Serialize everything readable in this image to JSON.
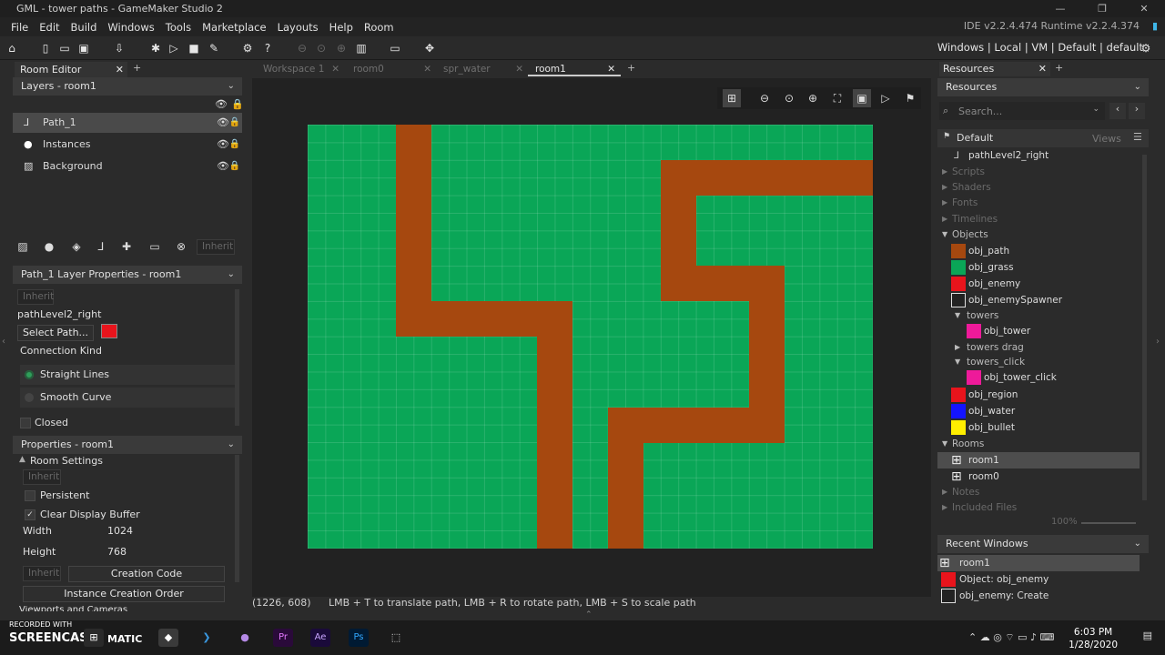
{
  "window": {
    "title": "GML - tower paths - GameMaker Studio 2",
    "version": "IDE v2.2.4.474  Runtime v2.2.4.374"
  },
  "menu": [
    "File",
    "Edit",
    "Build",
    "Windows",
    "Tools",
    "Marketplace",
    "Layouts",
    "Help",
    "Room"
  ],
  "targets": "Windows | Local | VM | Default | default",
  "left": {
    "tab": "Room Editor",
    "layers_header": "Layers - room1",
    "layers": [
      {
        "name": "Path_1",
        "icon": "path-icon"
      },
      {
        "name": "Instances",
        "icon": "circle-icon"
      },
      {
        "name": "Background",
        "icon": "image-icon"
      }
    ],
    "inherit": "Inherit",
    "layer_props_header": "Path_1 Layer Properties - room1",
    "path_name": "pathLevel2_right",
    "select_path": "Select Path...",
    "path_color": "#e8141c",
    "connection_kind": "Connection Kind",
    "straight": "Straight Lines",
    "smooth": "Smooth Curve",
    "closed": "Closed",
    "props_header": "Properties - room1",
    "room_settings": "Room Settings",
    "persistent": "Persistent",
    "clear_display": "Clear Display Buffer",
    "width_label": "Width",
    "width_value": "1024",
    "height_label": "Height",
    "height_value": "768",
    "creation_code": "Creation Code",
    "instance_order": "Instance Creation Order",
    "viewports": "Viewports and Cameras"
  },
  "doc_tabs": [
    {
      "label": "Workspace 1",
      "active": false
    },
    {
      "label": "room0",
      "active": false
    },
    {
      "label": "spr_water",
      "active": false
    },
    {
      "label": "room1",
      "active": true
    }
  ],
  "status": {
    "coords": "(1226, 608)",
    "hint": "LMB + T to translate path, LMB + R to rotate path, LMB + S to scale path"
  },
  "right": {
    "tab": "Resources",
    "header": "Resources",
    "search_placeholder": "Search...",
    "default": "Default",
    "views": "Views",
    "path_item": "pathLevel2_right",
    "groups": {
      "scripts": "Scripts",
      "shaders": "Shaders",
      "fonts": "Fonts",
      "timelines": "Timelines",
      "objects": "Objects",
      "rooms": "Rooms",
      "notes": "Notes",
      "included": "Included Files"
    },
    "objects": [
      {
        "name": "obj_path",
        "color": "#a6480f"
      },
      {
        "name": "obj_grass",
        "color": "#0aa657"
      },
      {
        "name": "obj_enemy",
        "color": "#e8141c"
      },
      {
        "name": "obj_enemySpawner",
        "color": "#ffffff"
      }
    ],
    "towers": "towers",
    "obj_tower": "obj_tower",
    "towers_drag": "towers drag",
    "towers_click": "towers_click",
    "obj_tower_click": "obj_tower_click",
    "objects2": [
      {
        "name": "obj_region",
        "color": "#e8141c"
      },
      {
        "name": "obj_water",
        "color": "#1414ff"
      },
      {
        "name": "obj_bullet",
        "color": "#ffee00"
      }
    ],
    "rooms": [
      "room1",
      "room0"
    ],
    "zoom": "100%",
    "recent_header": "Recent Windows",
    "recent": [
      {
        "label": "room1"
      },
      {
        "label": "Object: obj_enemy"
      },
      {
        "label": "obj_enemy: Create"
      }
    ]
  },
  "taskbar": {
    "recorded": "RECORDED WITH",
    "brand": "SCREENCAST",
    "matic": "MATIC",
    "time": "6:03 PM",
    "date": "1/28/2020"
  }
}
